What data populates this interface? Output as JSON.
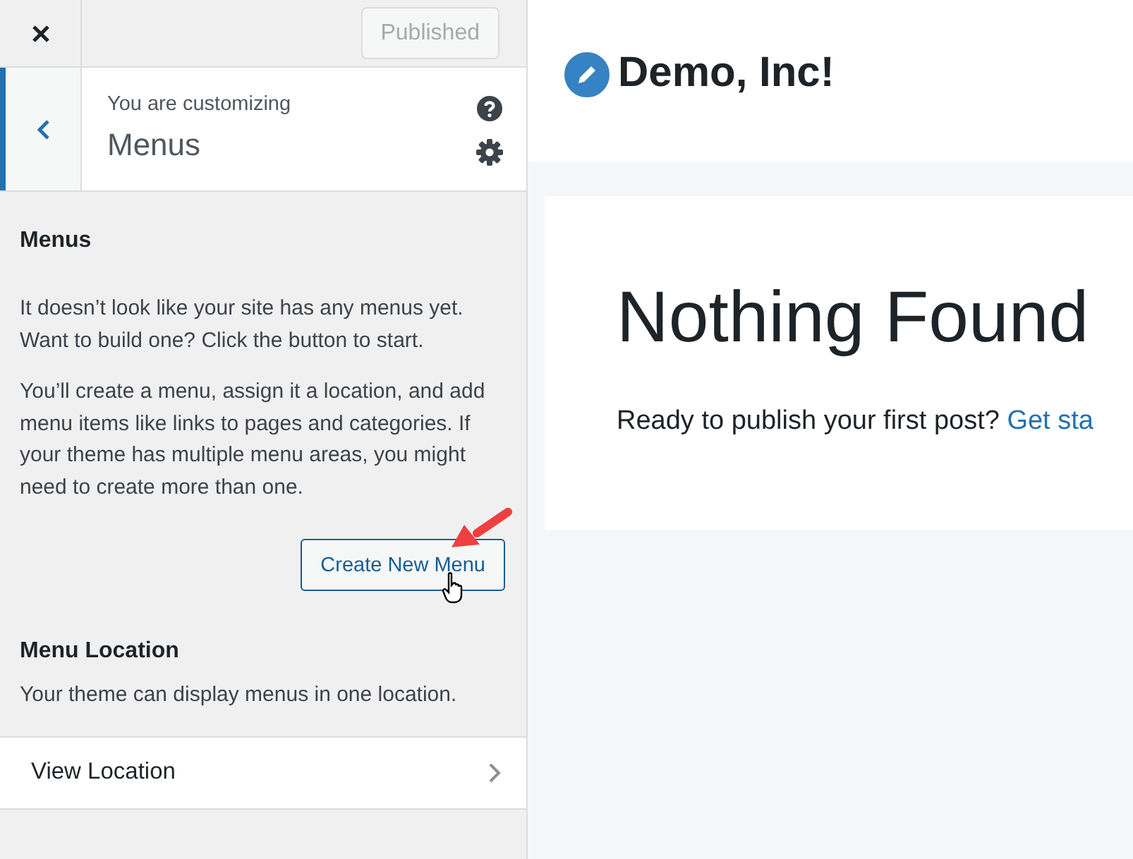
{
  "top_bar": {
    "publish_button": {
      "label": "Published",
      "disabled": true
    }
  },
  "section_header": {
    "eyebrow": "You are customizing",
    "title": "Menus"
  },
  "menus_panel": {
    "heading": "Menus",
    "paragraphs": [
      "It doesn’t look like your site has any menus yet. Want to build one? Click the button to start.",
      "You’ll create a menu, assign it a location, and add menu items like links to pages and categories. If your theme has multiple menu areas, you might need to create more than one."
    ],
    "create_button": "Create New Menu"
  },
  "location_panel": {
    "heading": "Menu Location",
    "description": "Your theme can display menus in one location.",
    "item": "View Location"
  },
  "preview": {
    "site_title": "Demo, Inc!",
    "heading": "Nothing Found",
    "message": "Ready to publish your first post?",
    "link": "Get sta"
  }
}
